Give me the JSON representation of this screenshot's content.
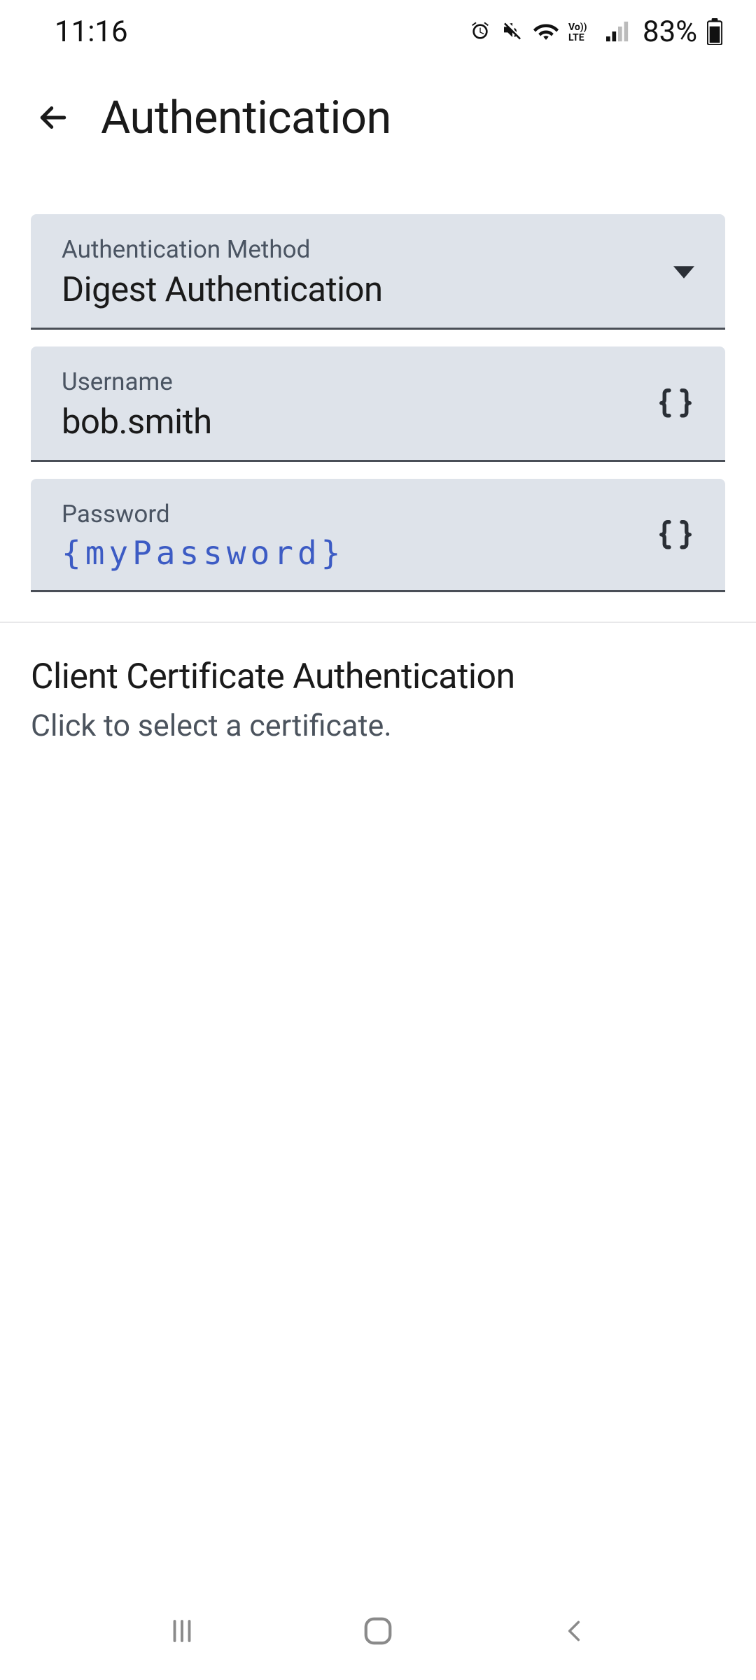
{
  "status": {
    "time": "11:16",
    "battery_text": "83%"
  },
  "header": {
    "title": "Authentication"
  },
  "fields": {
    "method": {
      "label": "Authentication Method",
      "value": "Digest Authentication"
    },
    "username": {
      "label": "Username",
      "value": "bob.smith"
    },
    "password": {
      "label": "Password",
      "value": "{myPassword}"
    }
  },
  "client_cert": {
    "title": "Client Certificate Authentication",
    "subtitle": "Click to select a certificate."
  }
}
